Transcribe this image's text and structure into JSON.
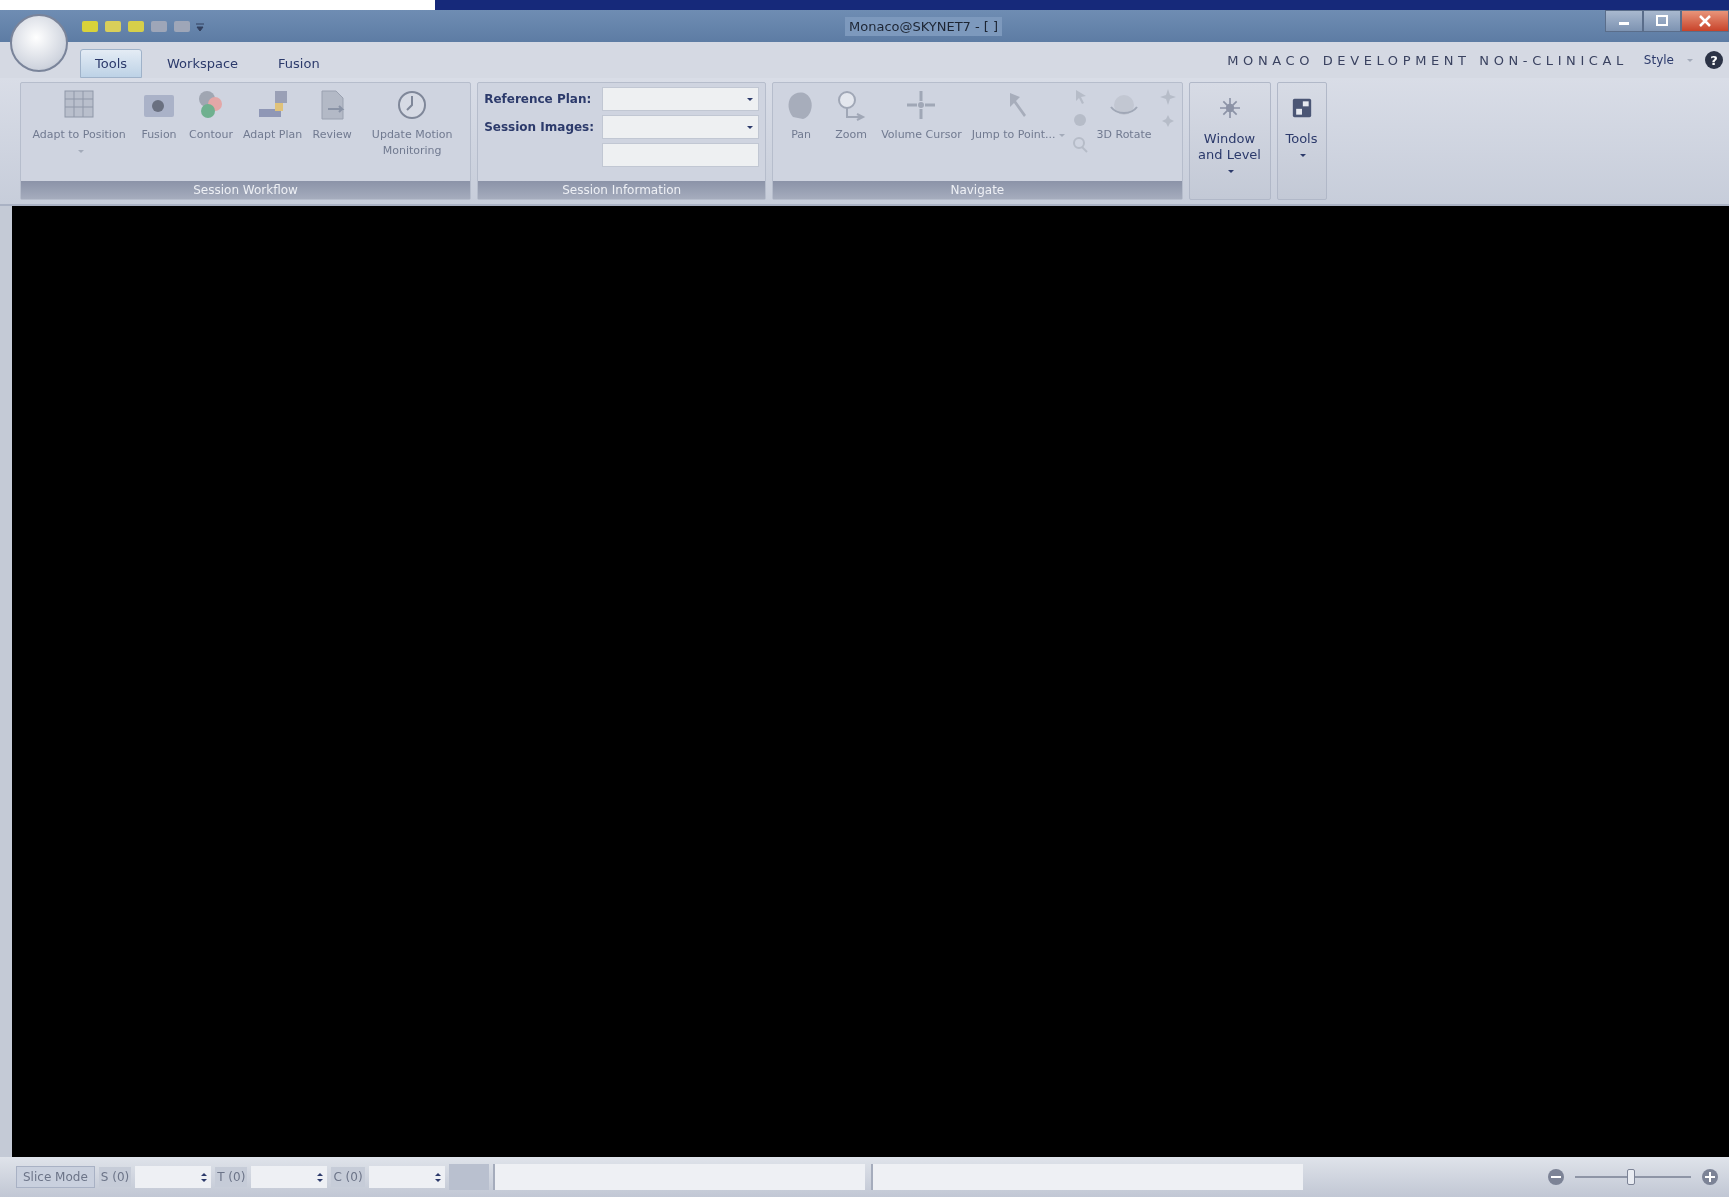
{
  "window": {
    "title": "Monaco@SKYNET7 - [ ]"
  },
  "tabs": [
    {
      "label": "Tools",
      "selected": true
    },
    {
      "label": "Workspace",
      "selected": false
    },
    {
      "label": "Fusion",
      "selected": false
    }
  ],
  "banner": "MONACO DEVELOPMENT NON-CLINICAL",
  "style_menu": "Style",
  "help": "?",
  "ribbon": {
    "session_workflow": {
      "title": "Session Workflow",
      "buttons": [
        {
          "label": "Adapt to Position",
          "dropdown": true,
          "disabled": true
        },
        {
          "label": "Fusion",
          "dropdown": false,
          "disabled": true
        },
        {
          "label": "Contour",
          "dropdown": false,
          "disabled": true
        },
        {
          "label": "Adapt Plan",
          "dropdown": false,
          "disabled": true
        },
        {
          "label": "Review",
          "dropdown": false,
          "disabled": true
        },
        {
          "label": "Update Motion Monitoring",
          "dropdown": false,
          "disabled": true
        }
      ]
    },
    "session_information": {
      "title": "Session Information",
      "fields": [
        {
          "label": "Reference Plan:"
        },
        {
          "label": "Session Images:"
        }
      ]
    },
    "navigate": {
      "title": "Navigate",
      "buttons": [
        {
          "label": "Pan",
          "dropdown": false,
          "disabled": true
        },
        {
          "label": "Zoom",
          "dropdown": false,
          "disabled": true
        },
        {
          "label": "Volume Cursor",
          "dropdown": false,
          "disabled": true
        },
        {
          "label": "Jump to Point...",
          "dropdown": true,
          "disabled": true
        },
        {
          "label": "3D Rotate",
          "dropdown": false,
          "disabled": true
        }
      ]
    },
    "extra_buttons": [
      {
        "label": "Window and Level",
        "dropdown": true,
        "disabled": false
      },
      {
        "label": "Tools",
        "dropdown": true,
        "disabled": false
      }
    ]
  },
  "status_bar": {
    "mode_button": "Slice Mode",
    "spinners": [
      {
        "label": "S (0)"
      },
      {
        "label": "T (0)"
      },
      {
        "label": "C (0)"
      }
    ],
    "zoom_slider": {
      "level": 0.47
    }
  }
}
